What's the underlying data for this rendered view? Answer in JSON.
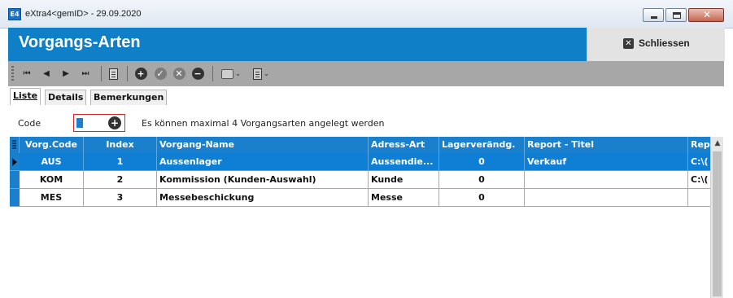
{
  "window": {
    "title": "eXtra4<gemID> - 29.09.2020",
    "app_icon_text": "E4",
    "min_icon": "minimize-icon",
    "max_icon": "maximize-icon",
    "close_glyph": "✕"
  },
  "header": {
    "title": "Vorgangs-Arten",
    "close_button_label": "Schliessen",
    "close_icon_glyph": "✕",
    "accent_color": "#0f7fc7"
  },
  "toolbar": {
    "items": [
      "first-record-icon",
      "prev-record-icon",
      "next-record-icon",
      "last-record-icon",
      "list-icon",
      "add-icon",
      "confirm-icon",
      "cancel-icon",
      "delete-icon",
      "print-icon",
      "form-icon"
    ],
    "glyph_first": "⏮",
    "glyph_prev": "◀",
    "glyph_next": "▶",
    "glyph_last": "⏭",
    "glyph_add": "+",
    "glyph_confirm": "✓",
    "glyph_cancel": "✕",
    "glyph_delete": "−",
    "glyph_dropdown": "⌄"
  },
  "tabs": [
    {
      "label": "Liste",
      "active": true
    },
    {
      "label": "Details",
      "active": false
    },
    {
      "label": "Bemerkungen",
      "active": false
    }
  ],
  "filter": {
    "code_label": "Code",
    "code_value": "",
    "plus_glyph": "+",
    "info_text": "Es können maximal 4 Vorgangsarten angelegt werden"
  },
  "grid": {
    "columns": [
      "Vorg.Code",
      "Index",
      "Vorgang-Name",
      "Adress-Art",
      "Lagerverändg.",
      "Report - Titel",
      "Rep"
    ],
    "rows": [
      {
        "code": "AUS",
        "index": "1",
        "name": "Aussenlager",
        "adress_art": "Aussendie...",
        "lager": "0",
        "report_titel": "Verkauf",
        "rep": "C:\\(",
        "selected": true
      },
      {
        "code": "KOM",
        "index": "2",
        "name": "Kommission (Kunden-Auswahl)",
        "adress_art": "Kunde",
        "lager": "0",
        "report_titel": "",
        "rep": "C:\\(",
        "selected": false
      },
      {
        "code": "MES",
        "index": "3",
        "name": "Messebeschickung",
        "adress_art": "Messe",
        "lager": "0",
        "report_titel": "",
        "rep": "",
        "selected": false
      }
    ],
    "header_color": "#1a7fcc",
    "selected_color": "#0f7fd6"
  },
  "scrollbar": {
    "up_glyph": "▲"
  }
}
